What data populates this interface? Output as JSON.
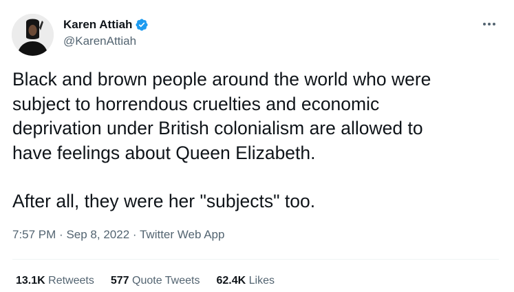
{
  "author": {
    "display_name": "Karen Attiah",
    "handle": "@KarenAttiah",
    "verified_icon": "verified-badge-icon",
    "verified_color": "#1d9bf0"
  },
  "tweet": {
    "paragraph1_lines": [
      "Black and brown people around the world who were",
      "subject to horrendous cruelties and economic",
      "deprivation under British colonialism are allowed to",
      "have feelings about Queen Elizabeth."
    ],
    "paragraph2": "After all, they were her \"subjects\" too."
  },
  "meta": {
    "time": "7:57 PM",
    "date": "Sep 8, 2022",
    "source": "Twitter Web App",
    "separator": "·"
  },
  "stats": {
    "retweets_count": "13.1K",
    "retweets_label": "Retweets",
    "quotes_count": "577",
    "quotes_label": "Quote Tweets",
    "likes_count": "62.4K",
    "likes_label": "Likes"
  },
  "icons": {
    "more": "more-options-icon"
  },
  "colors": {
    "text": "#0f1419",
    "secondary": "#536471",
    "divider": "#eff3f4"
  }
}
